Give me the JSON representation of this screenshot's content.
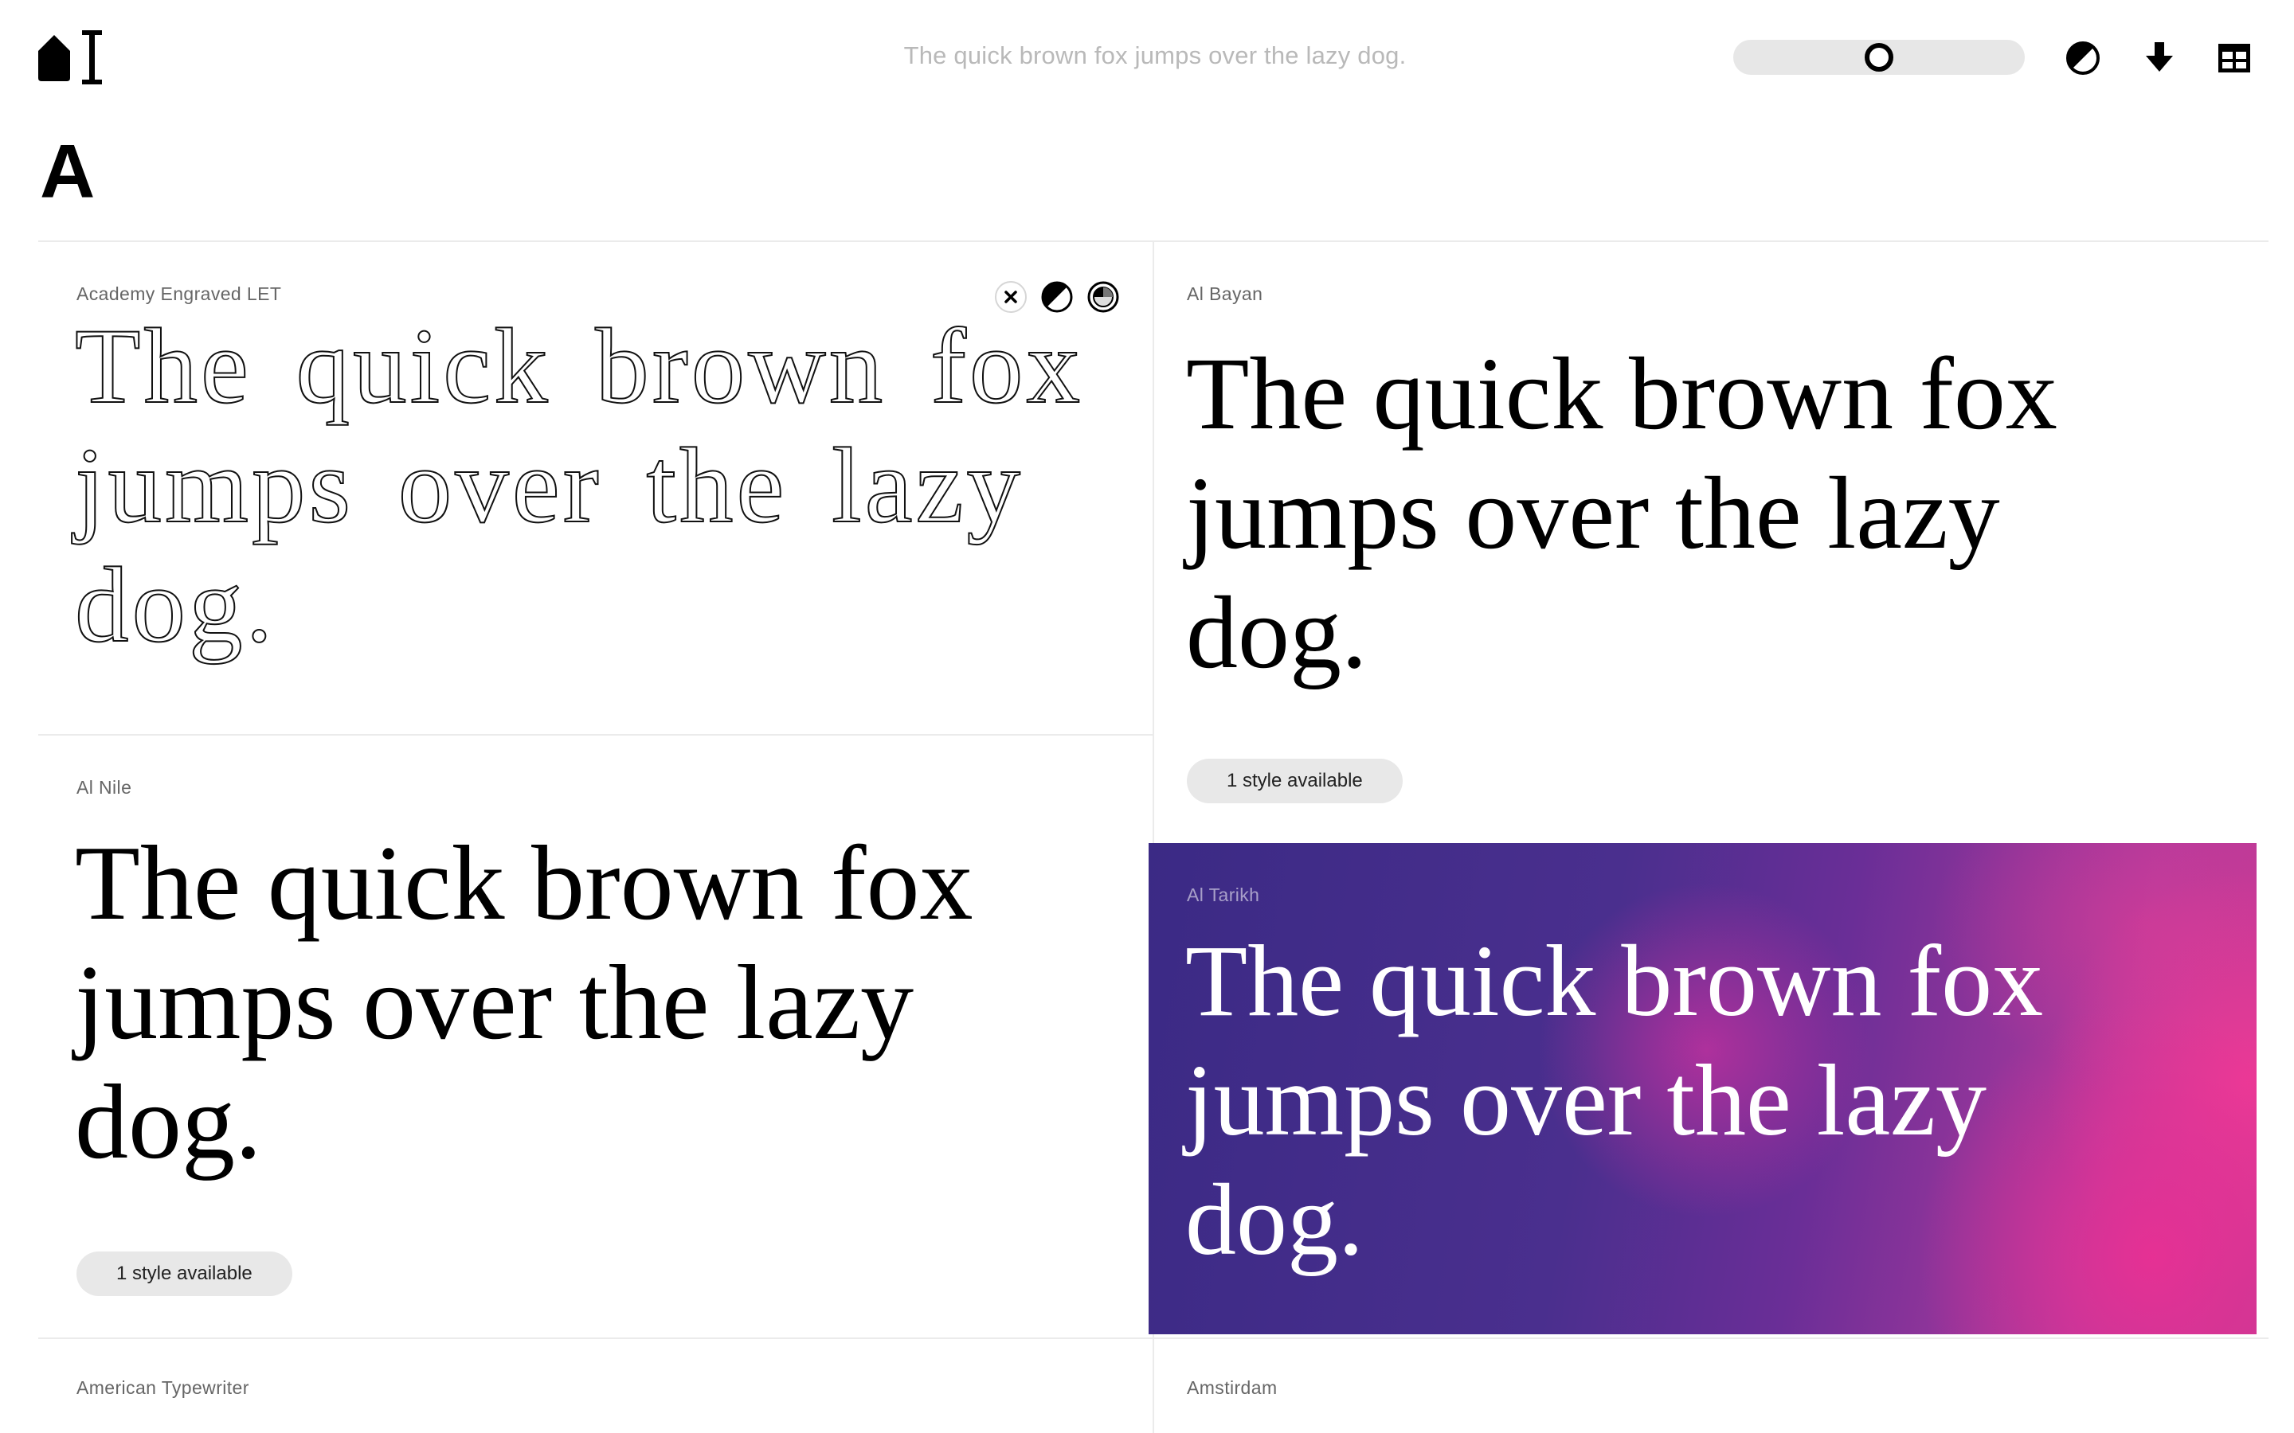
{
  "header": {
    "preview_text": "The quick brown fox jumps over the lazy dog.",
    "size_slider_value": 0.5,
    "icons": [
      "home-logo-icon",
      "text-cursor-icon",
      "contrast-icon",
      "download-icon",
      "grid-layout-icon"
    ]
  },
  "section": {
    "letter": "A"
  },
  "fonts": [
    {
      "name": "Academy Engraved LET",
      "sample": "The quick brown fox jumps over the lazy dog.",
      "controls": [
        "close-icon",
        "contrast-icon",
        "color-picker-icon"
      ]
    },
    {
      "name": "Al Bayan",
      "sample": "The quick brown fox jumps over the lazy dog.",
      "styles_label": "1 style available"
    },
    {
      "name": "Al Nile",
      "sample": "The quick brown fox jumps over the lazy dog.",
      "styles_label": "1 style available"
    },
    {
      "name": "Al Tarikh",
      "sample": "The quick brown fox jumps over the lazy dog.",
      "background": "purple-pink-gradient"
    },
    {
      "name": "American Typewriter"
    },
    {
      "name": "Amstirdam"
    }
  ],
  "colors": {
    "accent_pink": "#e8308f",
    "accent_purple": "#3b2a85",
    "pill_bg": "#e8e8e8",
    "divider": "#ebebeb"
  }
}
